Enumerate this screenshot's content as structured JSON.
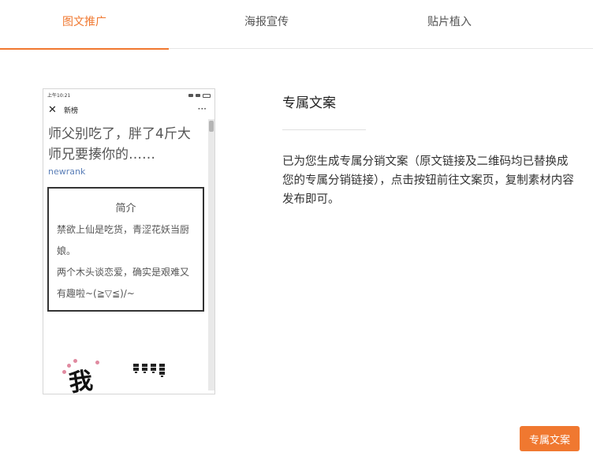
{
  "tabs": [
    {
      "label": "图文推广",
      "active": true
    },
    {
      "label": "海报宣传",
      "active": false
    },
    {
      "label": "贴片植入",
      "active": false
    }
  ],
  "phone": {
    "status_time": "上午10:21",
    "nav_title": "新榜",
    "nav_more": "···",
    "article": {
      "title": "师父别吃了，胖了4斤大师兄要揍你的……",
      "author": "newrank",
      "intro_title": "简介",
      "intro_paragraphs": [
        "禁欲上仙是吃货，青涩花妖当厨娘。",
        "两个木头谈恋爱，确实是艰难又有趣啦~(≧▽≦)/~"
      ],
      "calligraphy": "我"
    }
  },
  "content": {
    "title": "专属文案",
    "description": "已为您生成专属分销文案（原文链接及二维码均已替换成您的专属分销链接），点击按钮前往文案页，复制素材内容发布即可。"
  },
  "cta_label": "专属文案",
  "colors": {
    "accent": "#f07830",
    "link": "#5b7fb8"
  }
}
